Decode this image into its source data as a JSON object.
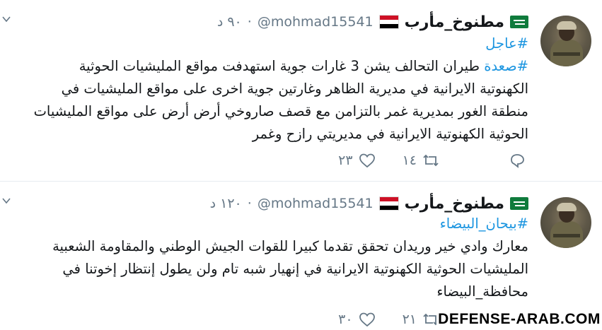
{
  "tweets": [
    {
      "display_name": "مطنوخ_مأرب",
      "handle": "@mohmad15541",
      "dot": "·",
      "time": "٩٠ د",
      "lines": [
        {
          "hashtag": "#عاجل",
          "text": ""
        },
        {
          "hashtag": "#صعدة",
          "text": " طيران التحالف يشن 3 غارات جوية استهدفت مواقع المليشيات الحوثية"
        },
        {
          "hashtag": "",
          "text": "الكهنوتية الايرانية في مديرية الظاهر وغارتين جوية اخرى على مواقع المليشيات في"
        },
        {
          "hashtag": "",
          "text": "منطقة الغور بمديرية غمر بالتزامن مع قصف صاروخي أرض أرض على مواقع المليشيات"
        },
        {
          "hashtag": "",
          "text": "الحوثية الكهنوتية الايرانية في مديريتي رازح وغمر"
        }
      ],
      "retweets": "١٤",
      "likes": "٢٣"
    },
    {
      "display_name": "مطنوخ_مأرب",
      "handle": "@mohmad15541",
      "dot": "·",
      "time": "١٢٠ د",
      "lines": [
        {
          "hashtag": "#بيحان_البيضاء",
          "text": ""
        },
        {
          "hashtag": "",
          "text": "معارك وادي خير وريدان تحقق تقدما كبيرا للقوات الجيش الوطني والمقاومة الشعبية"
        },
        {
          "hashtag": "",
          "text": "المليشيات الحوثية الكهنوتية الايرانية في إنهيار شبه تام ولن يطول إنتظار إخوتنا في"
        },
        {
          "hashtag": "",
          "text": "محافظة_البيضاء"
        }
      ],
      "retweets": "٢١",
      "likes": "٣٠"
    }
  ],
  "watermark": "DEFENSE-ARAB.COM",
  "colors": {
    "link": "#1b95e0",
    "muted": "#657786",
    "text": "#14171a",
    "flag_sa_green": "#0f7b3c",
    "flag_ye_red": "#ce1126",
    "flag_ye_black": "#000000"
  },
  "icons": [
    "avatar",
    "saudi-flag-icon",
    "yemen-flag-icon",
    "chevron-down-icon",
    "reply-icon",
    "retweet-icon",
    "like-icon"
  ]
}
